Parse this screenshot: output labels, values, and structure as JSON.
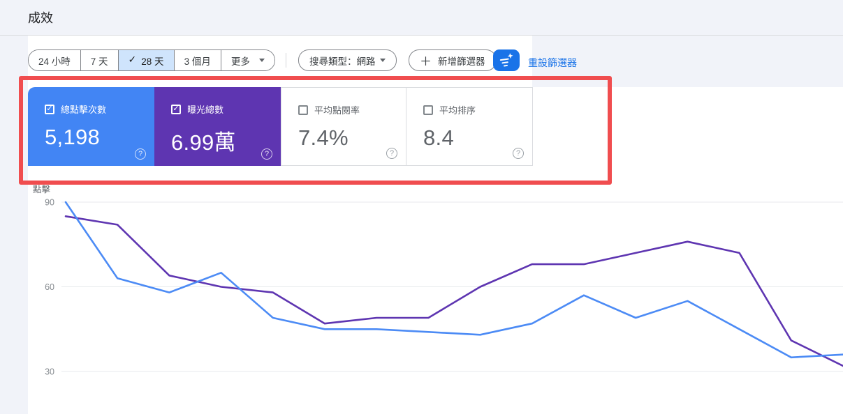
{
  "page": {
    "title": "成效"
  },
  "toolbar": {
    "date_ranges": [
      {
        "label": "24 小時",
        "selected": false
      },
      {
        "label": "7 天",
        "selected": false
      },
      {
        "label": "28 天",
        "selected": true
      },
      {
        "label": "3 個月",
        "selected": false
      },
      {
        "label": "更多",
        "selected": false
      }
    ],
    "search_type_chip": "搜尋類型：網路",
    "add_filter_chip": "新增篩選器",
    "reset_filters_link": "重設篩選器"
  },
  "cards": [
    {
      "id": "clicks",
      "label": "總點擊次數",
      "value": "5,198",
      "checked": true,
      "bg": "#4285f4"
    },
    {
      "id": "impressions",
      "label": "曝光總數",
      "value": "6.99萬",
      "checked": true,
      "bg": "#5e35b1"
    },
    {
      "id": "ctr",
      "label": "平均點閱率",
      "value": "7.4%",
      "checked": false,
      "bg": "#ffffff"
    },
    {
      "id": "position",
      "label": "平均排序",
      "value": "8.4",
      "checked": false,
      "bg": "#ffffff"
    }
  ],
  "chart_data": {
    "type": "line",
    "ylabel": "點擊",
    "yticks": [
      90,
      60,
      30
    ],
    "ylim": [
      20,
      95
    ],
    "grid": true,
    "legend_position": "none",
    "x_axis_labels_visible": false,
    "series": [
      {
        "name": "曝光總數",
        "color": "#5e35b1",
        "values": [
          85,
          82,
          64,
          60,
          58,
          47,
          49,
          49,
          60,
          68,
          68,
          72,
          76,
          72,
          41,
          32
        ]
      },
      {
        "name": "總點擊次數",
        "color": "#4c8bf5",
        "values": [
          90,
          63,
          58,
          65,
          49,
          45,
          45,
          44,
          43,
          47,
          57,
          49,
          55,
          45,
          35,
          36
        ]
      }
    ]
  },
  "colors": {
    "accent_blue": "#1a73e8",
    "card_blue": "#4285f4",
    "card_purple": "#5e35b1",
    "selected_chip_bg": "#cfe4fc",
    "annotation_red": "#f04d4f",
    "gridline": "#e7e9ec",
    "axis_text": "#868b90"
  }
}
